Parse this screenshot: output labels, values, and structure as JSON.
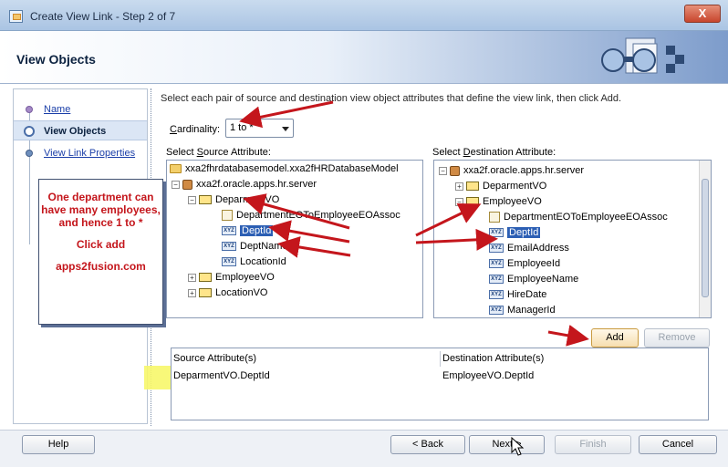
{
  "window": {
    "title": "Create View Link - Step 2 of 7",
    "close_glyph": "X"
  },
  "header": {
    "title": "View Objects"
  },
  "nav": {
    "items": [
      {
        "label": "Name",
        "state": "done"
      },
      {
        "label": "View Objects",
        "state": "active"
      },
      {
        "label": "View Link Properties",
        "state": "link"
      }
    ]
  },
  "instruction": "Select each pair of source and destination view object attributes that define the view link, then click Add.",
  "cardinality": {
    "label_prefix": "C",
    "label_rest": "ardinality:",
    "value": "1 to *"
  },
  "source": {
    "label_prefix": "Select ",
    "label_u": "S",
    "label_rest": "ource Attribute:",
    "nodes": [
      {
        "text": "xxa2fhrdatabasemodel.xxa2fHRDatabaseModel",
        "icon": "folder-icon"
      },
      {
        "text": "xxa2f.oracle.apps.hr.server",
        "icon": "package-icon"
      },
      {
        "text": "DeparmentVO",
        "icon": "view-object-icon"
      },
      {
        "text": "DepartmentEOToEmployeeEOAssoc",
        "icon": "association-icon"
      },
      {
        "text": "DeptId",
        "icon": "attribute-icon"
      },
      {
        "text": "DeptName",
        "icon": "attribute-icon"
      },
      {
        "text": "LocationId",
        "icon": "attribute-icon"
      },
      {
        "text": "EmployeeVO",
        "icon": "view-object-icon"
      },
      {
        "text": "LocationVO",
        "icon": "view-object-icon"
      }
    ]
  },
  "destination": {
    "label_prefix": "Select ",
    "label_u": "D",
    "label_rest": "estination Attribute:",
    "nodes": [
      {
        "text": "xxa2f.oracle.apps.hr.server",
        "icon": "package-icon"
      },
      {
        "text": "DeparmentVO",
        "icon": "view-object-icon"
      },
      {
        "text": "EmployeeVO",
        "icon": "view-object-icon"
      },
      {
        "text": "DepartmentEOToEmployeeEOAssoc",
        "icon": "association-icon"
      },
      {
        "text": "DeptId",
        "icon": "attribute-icon"
      },
      {
        "text": "EmailAddress",
        "icon": "attribute-icon"
      },
      {
        "text": "EmployeeId",
        "icon": "attribute-icon"
      },
      {
        "text": "EmployeeName",
        "icon": "attribute-icon"
      },
      {
        "text": "HireDate",
        "icon": "attribute-icon"
      },
      {
        "text": "ManagerId",
        "icon": "attribute-icon"
      }
    ]
  },
  "buttons": {
    "add": "Add",
    "remove": "Remove",
    "help": "Help",
    "back": "< Back",
    "next": "Next >",
    "finish": "Finish",
    "cancel": "Cancel"
  },
  "table": {
    "headers": [
      "Source Attribute(s)",
      "Destination Attribute(s)"
    ],
    "rows": [
      [
        "DeparmentVO.DeptId",
        "EmployeeVO.DeptId"
      ]
    ]
  },
  "annotation": {
    "line1": "One department can have many employees, and hence 1 to *",
    "line2": "Click add",
    "line3": "apps2fusion.com",
    "color": "#c4161c"
  },
  "arrow_color": "#c4161c",
  "expander_glyphs": {
    "expanded": "−",
    "collapsed": "+"
  },
  "attribute_icon_text": "XYZ",
  "caret_glyph": "▾"
}
